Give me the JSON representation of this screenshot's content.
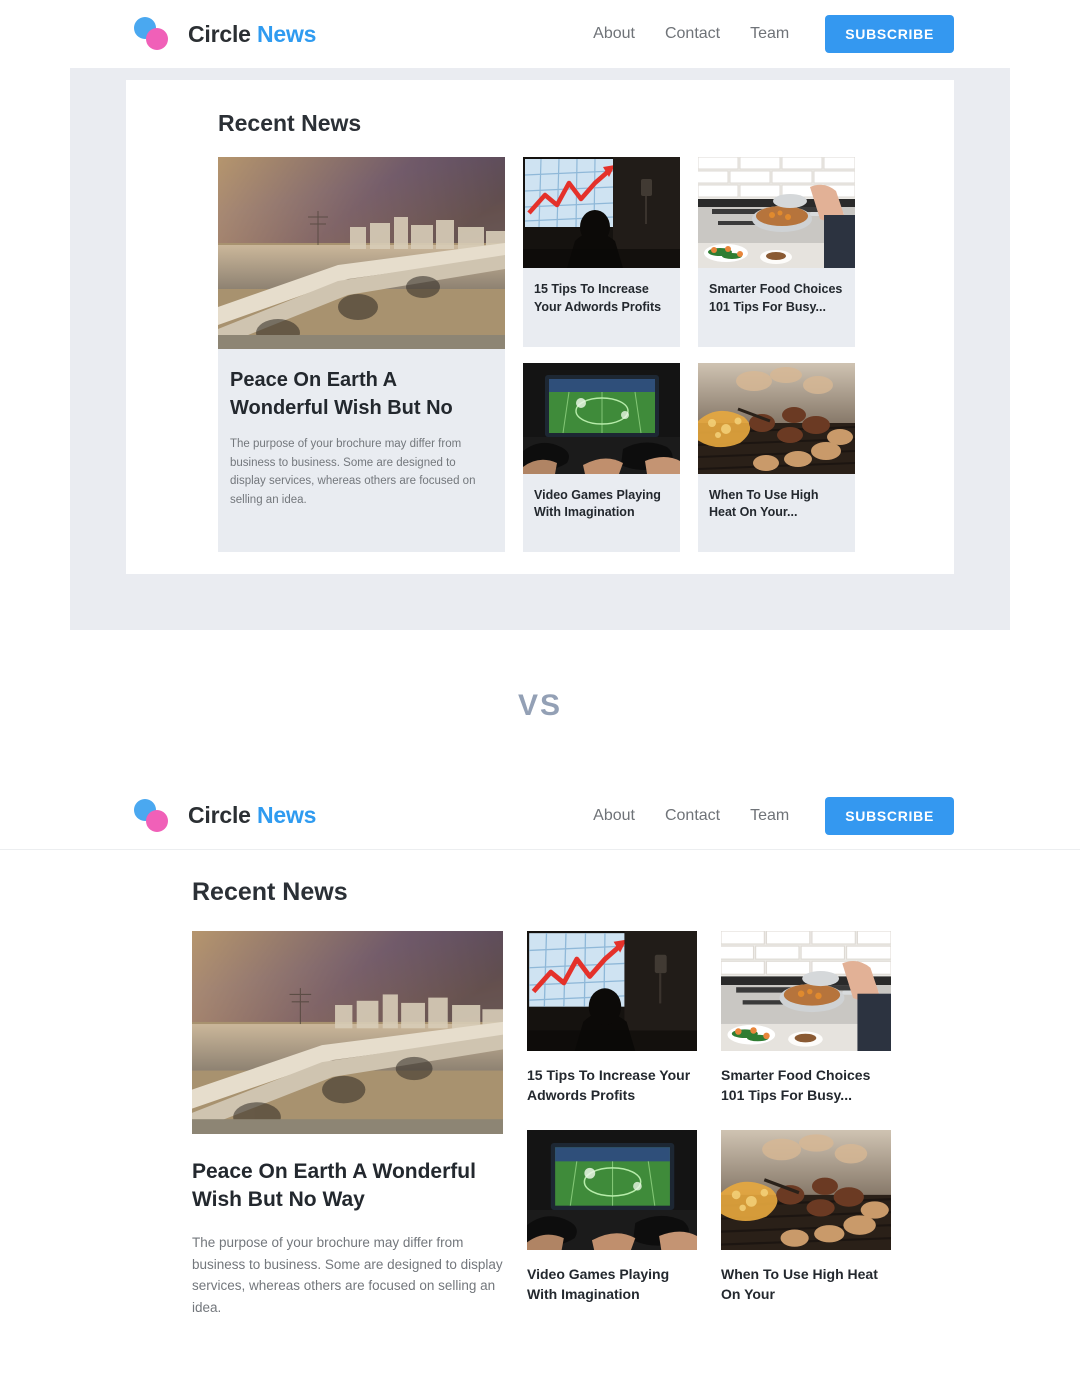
{
  "brand": {
    "name_primary": "Circle",
    "name_accent": "News",
    "logo_icon": "two-circles-logo",
    "color_blue": "#4aa8f0",
    "color_pink": "#f060b8",
    "accent_color": "#2f9bf0"
  },
  "nav": {
    "links": [
      {
        "label": "About"
      },
      {
        "label": "Contact"
      },
      {
        "label": "Team"
      }
    ],
    "subscribe_label": "SUBSCRIBE",
    "subscribe_color": "#3498f0"
  },
  "comparison": {
    "separator_label": "VS"
  },
  "variant_a": {
    "section_title": "Recent News",
    "featured": {
      "image": "sunset-city-bridge-photo",
      "title": "Peace On Earth A Wonderful Wish But No",
      "description": "The purpose of your brochure may differ from business to business. Some are designed to display services, whereas others are focused on selling an idea."
    },
    "cards": [
      {
        "image": "business-growth-chart-presentation-photo",
        "title": "15 Tips To Increase Your Adwords Profits"
      },
      {
        "image": "kitchen-stove-cooking-photo",
        "title": "Smarter Food Choices 101 Tips For Busy..."
      },
      {
        "image": "video-game-controllers-tv-photo",
        "title": "Video Games Playing With Imagination"
      },
      {
        "image": "bbq-grill-meat-photo",
        "title": "When To Use High Heat On Your..."
      }
    ]
  },
  "variant_b": {
    "section_title": "Recent News",
    "featured": {
      "image": "sunset-city-bridge-photo",
      "title": "Peace On Earth A Wonderful Wish But No Way",
      "description": "The purpose of your brochure may differ from business to business. Some are designed to display services, whereas others are focused on selling an idea."
    },
    "cards": [
      {
        "image": "business-growth-chart-presentation-photo",
        "title": "15 Tips To Increase Your Adwords Profits"
      },
      {
        "image": "kitchen-stove-cooking-photo",
        "title": "Smarter Food Choices 101 Tips For Busy..."
      },
      {
        "image": "video-game-controllers-tv-photo",
        "title": "Video Games Playing With Imagination"
      },
      {
        "image": "bbq-grill-meat-photo",
        "title": "When To Use High Heat On Your"
      }
    ]
  }
}
